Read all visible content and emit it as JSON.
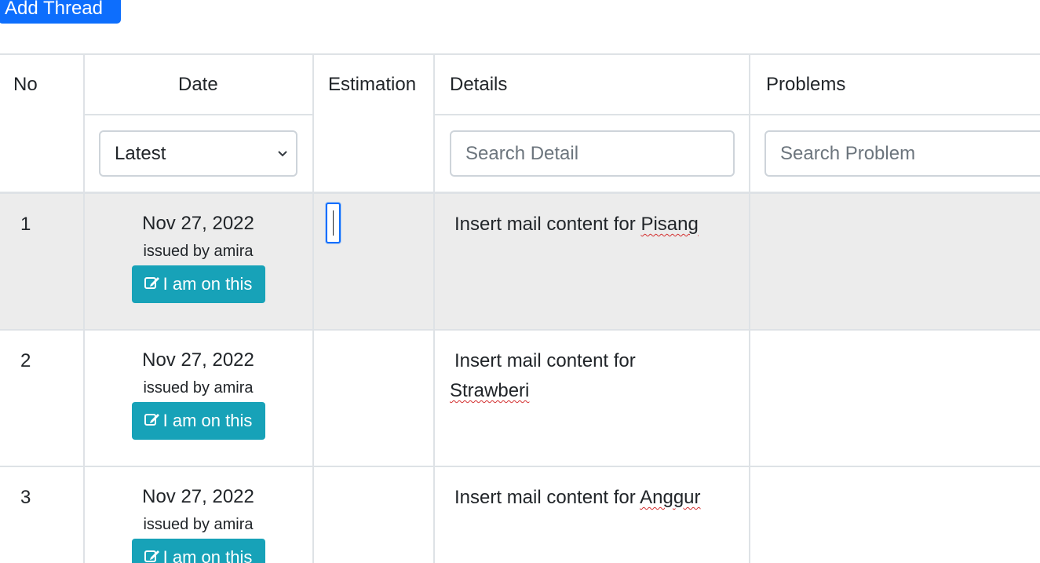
{
  "toolbar": {
    "add_thread_label": "Add Thread"
  },
  "table": {
    "headers": {
      "no": "No",
      "date": "Date",
      "estimation": "Estimation",
      "details": "Details",
      "problems": "Problems"
    },
    "filters": {
      "date_sort": "Latest",
      "detail_placeholder": "Search Detail",
      "problem_placeholder": "Search Problem"
    },
    "rows": [
      {
        "no": "1",
        "date": "Nov 27, 2022",
        "issued": "issued by amira",
        "action": "I am on this",
        "detail_prefix": "Insert mail content for",
        "detail_name": "Pisang",
        "problem": ""
      },
      {
        "no": "2",
        "date": "Nov 27, 2022",
        "issued": "issued by amira",
        "action": "I am on this",
        "detail_prefix": "Insert mail content for",
        "detail_name": "Strawberi",
        "problem": ""
      },
      {
        "no": "3",
        "date": "Nov 27, 2022",
        "issued": "issued by amira",
        "action": "I am on this",
        "detail_prefix": "Insert mail content for",
        "detail_name": "Anggur",
        "problem": ""
      }
    ]
  },
  "colors": {
    "primary": "#0d6efd",
    "info": "#17a2b8",
    "row_highlight": "#ececec",
    "border": "#dee2e6",
    "spell_error": "#d32f2f"
  },
  "icons": {
    "action_icon": "edit-icon",
    "select_icon": "chevron-down-icon"
  }
}
